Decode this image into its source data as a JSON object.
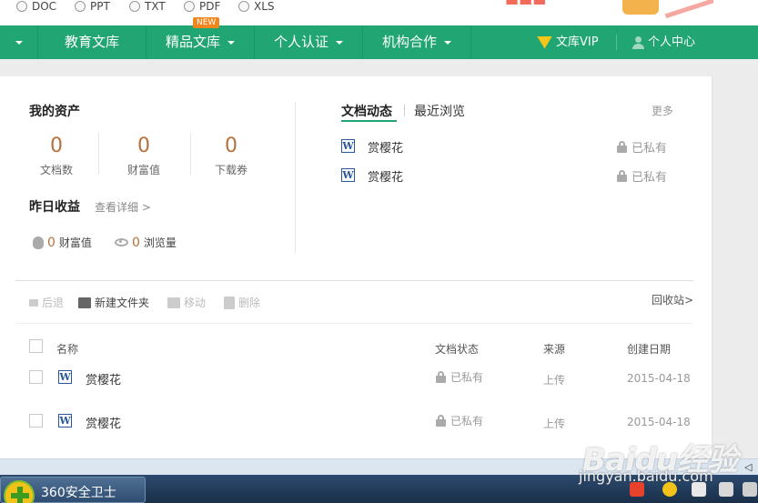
{
  "filetypes": [
    "DOC",
    "PPT",
    "TXT",
    "PDF",
    "XLS"
  ],
  "nav": {
    "items": [
      "教育文库",
      "精品文库",
      "个人认证",
      "机构合作"
    ],
    "new_badge": "NEW",
    "vip": "文库VIP",
    "user_center": "个人中心"
  },
  "assets": {
    "title": "我的资产",
    "stats": [
      {
        "value": "0",
        "label": "文档数"
      },
      {
        "value": "0",
        "label": "财富值"
      },
      {
        "value": "0",
        "label": "下载券"
      }
    ]
  },
  "yesterday": {
    "title": "昨日收益",
    "detail": "查看详细 >",
    "wealth_value": "0",
    "wealth_label": "财富值",
    "views_value": "0",
    "views_label": "浏览量"
  },
  "activity": {
    "tabs": [
      "文档动态",
      "最近浏览"
    ],
    "more": "更多",
    "items": [
      {
        "name": "赏樱花",
        "status": "已私有"
      },
      {
        "name": "赏樱花",
        "status": "已私有"
      }
    ]
  },
  "toolbar": {
    "back": "后退",
    "new_folder": "新建文件夹",
    "move": "移动",
    "delete": "删除",
    "recycle": "回收站>"
  },
  "table": {
    "headers": [
      "名称",
      "文档状态",
      "来源",
      "创建日期"
    ],
    "rows": [
      {
        "name": "赏樱花",
        "status": "已私有",
        "source": "上传",
        "date": "2015-04-18"
      },
      {
        "name": "赏樱花",
        "status": "已私有",
        "source": "上传",
        "date": "2015-04-18"
      }
    ]
  },
  "taskbar": {
    "app_label": "360安全卫士"
  },
  "watermark": {
    "brand": "Baidu经验",
    "url": "jingyan.baidu.com"
  }
}
